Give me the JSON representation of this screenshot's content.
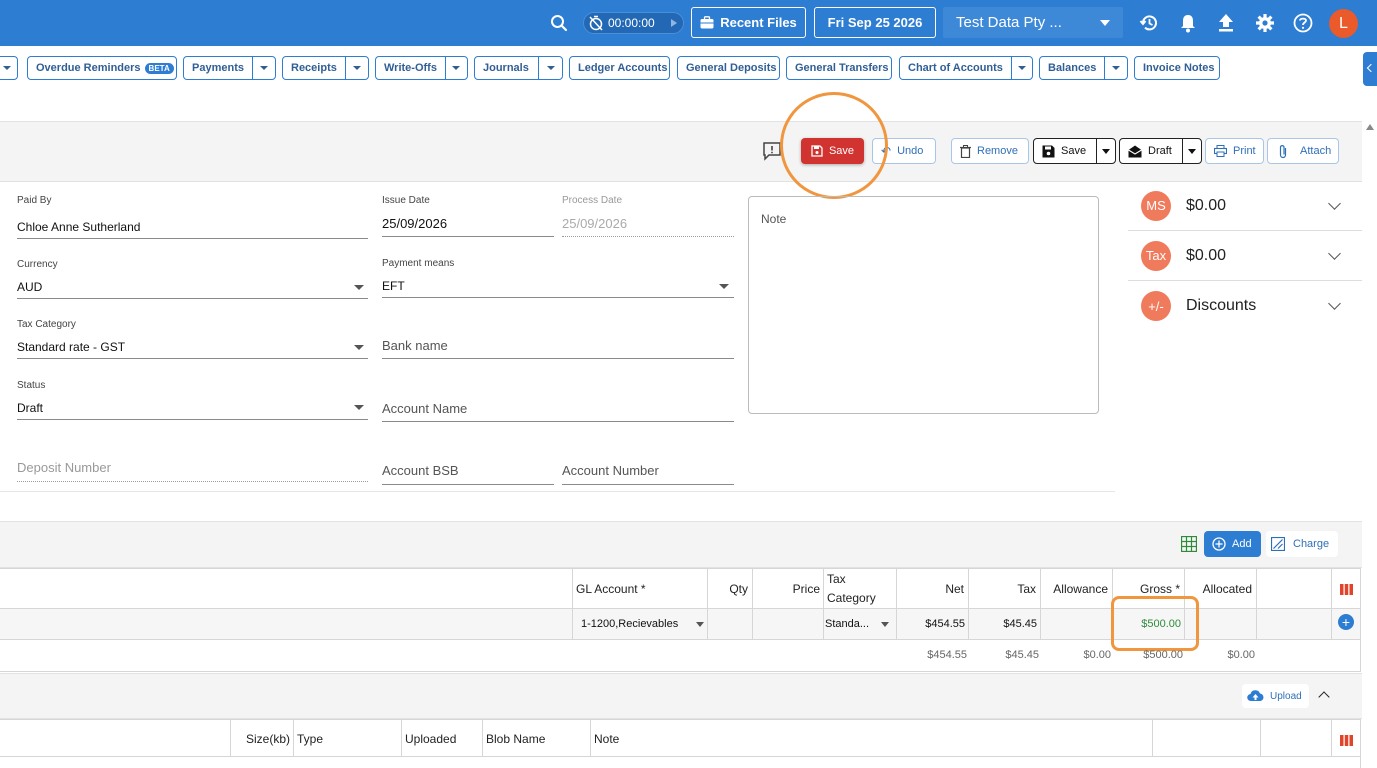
{
  "topbar": {
    "timer": "00:00:00",
    "recent_files": "Recent Files",
    "date": "Fri Sep 25 2026",
    "company": "Test Data Pty ...",
    "avatar_letter": "L"
  },
  "nav_tabs": [
    {
      "label": "Overdue Reminders",
      "badge": "BETA"
    },
    {
      "label": "Payments"
    },
    {
      "label": "Receipts"
    },
    {
      "label": "Write-Offs"
    },
    {
      "label": "Journals"
    },
    {
      "label": "Ledger Accounts"
    },
    {
      "label": "General Deposits"
    },
    {
      "label": "General Transfers"
    },
    {
      "label": "Chart of Accounts"
    },
    {
      "label": "Balances"
    },
    {
      "label": "Invoice Notes"
    }
  ],
  "actions": {
    "save": "Save",
    "undo": "Undo",
    "remove": "Remove",
    "save2": "Save",
    "draft": "Draft",
    "print": "Print",
    "attach": "Attach"
  },
  "form": {
    "paid_by_label": "Paid By",
    "paid_by": "Chloe Anne Sutherland",
    "issue_date_label": "Issue Date",
    "issue_date": "25/09/2026",
    "process_date_label": "Process Date",
    "process_date": "25/09/2026",
    "currency_label": "Currency",
    "currency": "AUD",
    "payment_means_label": "Payment means",
    "payment_means": "EFT",
    "tax_category_label": "Tax Category",
    "tax_category": "Standard rate - GST",
    "bank_name_placeholder": "Bank name",
    "status_label": "Status",
    "status": "Draft",
    "account_name_placeholder": "Account Name",
    "deposit_number_placeholder": "Deposit Number",
    "account_bsb_placeholder": "Account BSB",
    "account_number_placeholder": "Account Number",
    "note_placeholder": "Note"
  },
  "summary": [
    {
      "badge": "MS",
      "value": "$0.00"
    },
    {
      "badge": "Tax",
      "value": "$0.00"
    },
    {
      "badge": "+/-",
      "value": "Discounts"
    }
  ],
  "lines_toolbar": {
    "add": "Add",
    "charge": "Charge"
  },
  "lines_table": {
    "headers": {
      "gl_account": "GL Account *",
      "qty": "Qty",
      "price": "Price",
      "tax_category_1": "Tax",
      "tax_category_2": "Category",
      "net": "Net",
      "tax": "Tax",
      "allowance": "Allowance",
      "gross": "Gross *",
      "allocated": "Allocated"
    },
    "row": {
      "gl_account": "1-1200,Recievables",
      "tax_category": "Standa...",
      "net": "$454.55",
      "tax": "$45.45",
      "gross": "$500.00"
    },
    "totals": {
      "net": "$454.55",
      "tax": "$45.45",
      "allowance": "$0.00",
      "gross": "$500.00",
      "allocated": "$0.00"
    }
  },
  "attachments": {
    "upload": "Upload",
    "headers": {
      "size": "Size(kb)",
      "type": "Type",
      "uploaded": "Uploaded",
      "blob_name": "Blob Name",
      "note": "Note"
    }
  },
  "colors": {
    "brand": "#2d7dd2",
    "save_red": "#d03330",
    "highlight_ring": "#f0963e",
    "gross_green": "#2e8b3a",
    "summary_badge": "#f07a5c"
  }
}
